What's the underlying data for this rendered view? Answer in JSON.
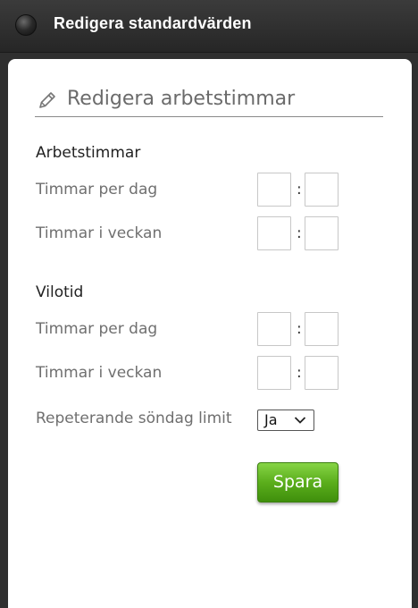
{
  "window": {
    "title": "Redigera standardvärden"
  },
  "form": {
    "header": "Redigera arbetstimmar",
    "sections": [
      {
        "title": "Arbetstimmar",
        "rows": [
          {
            "label": "Timmar per dag",
            "hours": "",
            "minutes": "",
            "separator": ":"
          },
          {
            "label": "Timmar i veckan",
            "hours": "",
            "minutes": "",
            "separator": ":"
          }
        ]
      },
      {
        "title": "Vilotid",
        "rows": [
          {
            "label": "Timmar per dag",
            "hours": "",
            "minutes": "",
            "separator": ":"
          },
          {
            "label": "Timmar i veckan",
            "hours": "",
            "minutes": "",
            "separator": ":"
          }
        ]
      }
    ],
    "repeat": {
      "label": "Repeterande söndag limit",
      "selected": "Ja"
    },
    "save_label": "Spara"
  },
  "colors": {
    "titlebar": "#2f2f2f",
    "save_button": "#5bae1c"
  },
  "icons": {
    "title": "window-dot-icon",
    "header": "pencil-icon",
    "select": "chevron-down-icon"
  }
}
